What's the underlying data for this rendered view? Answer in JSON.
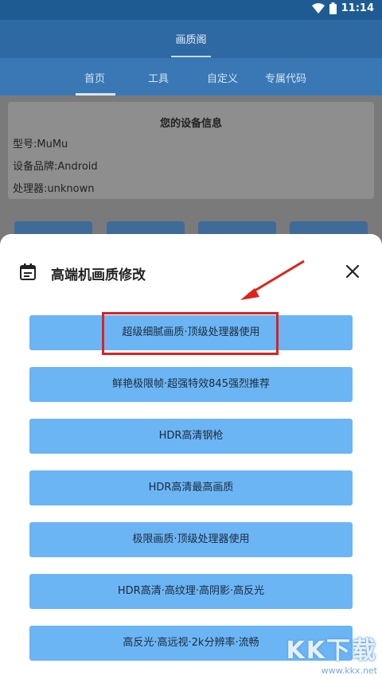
{
  "status_bar": {
    "time": "11:14"
  },
  "app_bar": {
    "title": "画质阁"
  },
  "tabs": [
    {
      "label": "首页",
      "active": true
    },
    {
      "label": "工具",
      "active": false
    },
    {
      "label": "自定义",
      "active": false
    },
    {
      "label": "专属代码",
      "active": false
    }
  ],
  "device_info": {
    "title": "您的设备信息",
    "lines": [
      "型号:MuMu",
      "设备品牌:Android",
      "处理器:unknown"
    ]
  },
  "sheet": {
    "title": "高端机画质修改",
    "options": [
      "超级细腻画质·顶级处理器使用",
      "鲜艳极限帧·超强特效845强烈推荐",
      "HDR高清钢枪",
      "HDR高清最高画质",
      "极限画质·顶级处理器使用",
      "HDR高清·高纹理·高阴影·高反光",
      "高反光·高远视·2k分辨率·流畅"
    ]
  },
  "watermark": {
    "logo": "KK下载",
    "url": "www.kkx.net"
  },
  "colors": {
    "status_bar": "#1f5b93",
    "app_bar": "#2e69a4",
    "option_button": "#6bb5f5",
    "highlight": "#e0211c"
  }
}
